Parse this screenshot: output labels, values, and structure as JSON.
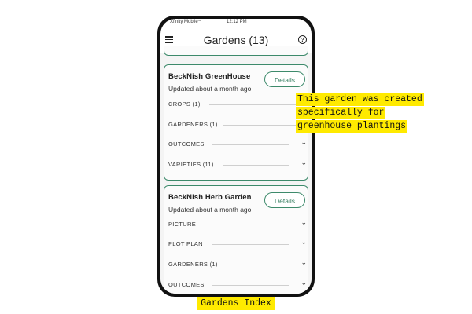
{
  "status_bar": {
    "carrier": "Xfinity Mobile",
    "time": "12:12 PM"
  },
  "app_bar": {
    "title": "Gardens (13)",
    "menu_icon": "hamburger-menu-icon",
    "help_icon": "help-circle-icon"
  },
  "gardens": [
    {
      "name": "BeckNish GreenHouse",
      "updated": "Updated about a month ago",
      "details_label": "Details",
      "sections": [
        {
          "label": "CROPS  (1)"
        },
        {
          "label": "GARDENERS  (1)"
        },
        {
          "label": "OUTCOMES"
        },
        {
          "label": "VARIETIES  (11)"
        }
      ]
    },
    {
      "name": "BeckNish Herb Garden",
      "updated": "Updated about a month ago",
      "details_label": "Details",
      "sections": [
        {
          "label": "PICTURE"
        },
        {
          "label": "PLOT PLAN"
        },
        {
          "label": "GARDENERS  (1)"
        },
        {
          "label": "OUTCOMES"
        }
      ]
    }
  ],
  "annotation": {
    "lines": [
      "This garden was created",
      "specifically for",
      "greenhouse plantings"
    ]
  },
  "caption": "Gardens Index",
  "colors": {
    "accent": "#3d8a6b",
    "highlight": "#ffea00",
    "frame": "#111111"
  }
}
